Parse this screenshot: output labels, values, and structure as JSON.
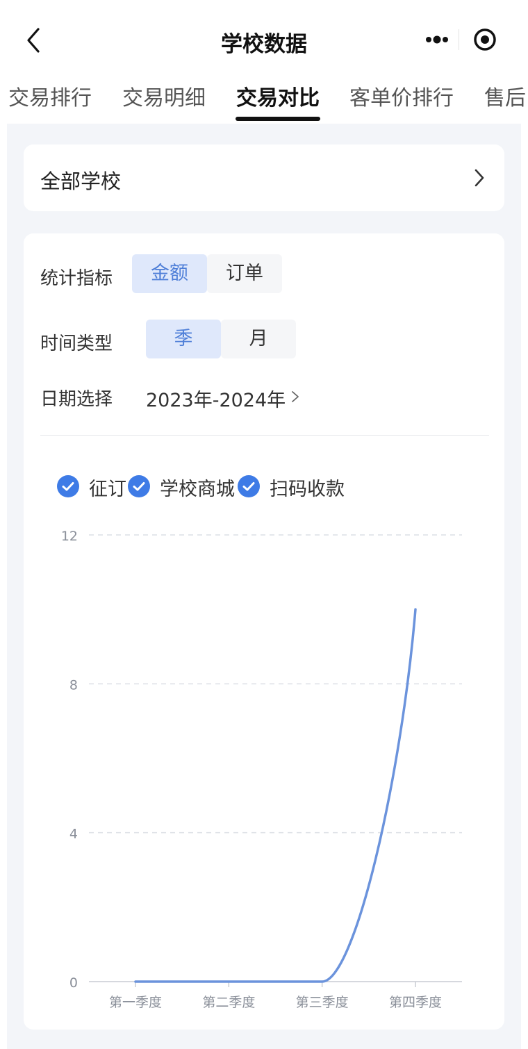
{
  "nav": {
    "title": "学校数据"
  },
  "tabs": [
    {
      "label": "交易排行",
      "active": false
    },
    {
      "label": "交易明细",
      "active": false
    },
    {
      "label": "交易对比",
      "active": true
    },
    {
      "label": "客单价排行",
      "active": false
    },
    {
      "label": "售后",
      "active": false
    }
  ],
  "school_selector": {
    "label": "全部学校"
  },
  "filters": {
    "metric_label": "统计指标",
    "metric_options": [
      "金额",
      "订单"
    ],
    "metric_selected": "金额",
    "time_type_label": "时间类型",
    "time_type_options": [
      "季",
      "月"
    ],
    "time_type_selected": "季",
    "date_label": "日期选择",
    "date_value": "2023年-2024年"
  },
  "legend": [
    {
      "label": "征订",
      "checked": true
    },
    {
      "label": "学校商城",
      "checked": true
    },
    {
      "label": "扫码收款",
      "checked": true
    }
  ],
  "colors": {
    "accent": "#4f7fd8",
    "check": "#3e7be6",
    "line": "#6b93dc",
    "bg": "#f3f5f9"
  },
  "chart_data": {
    "type": "line",
    "categories": [
      "第一季度",
      "第二季度",
      "第三季度",
      "第四季度"
    ],
    "series": [
      {
        "values": [
          0,
          0,
          0,
          10
        ]
      }
    ],
    "yticks": [
      0,
      4,
      8,
      12
    ],
    "ylim": [
      0,
      12
    ],
    "grid": true,
    "smooth": true
  }
}
